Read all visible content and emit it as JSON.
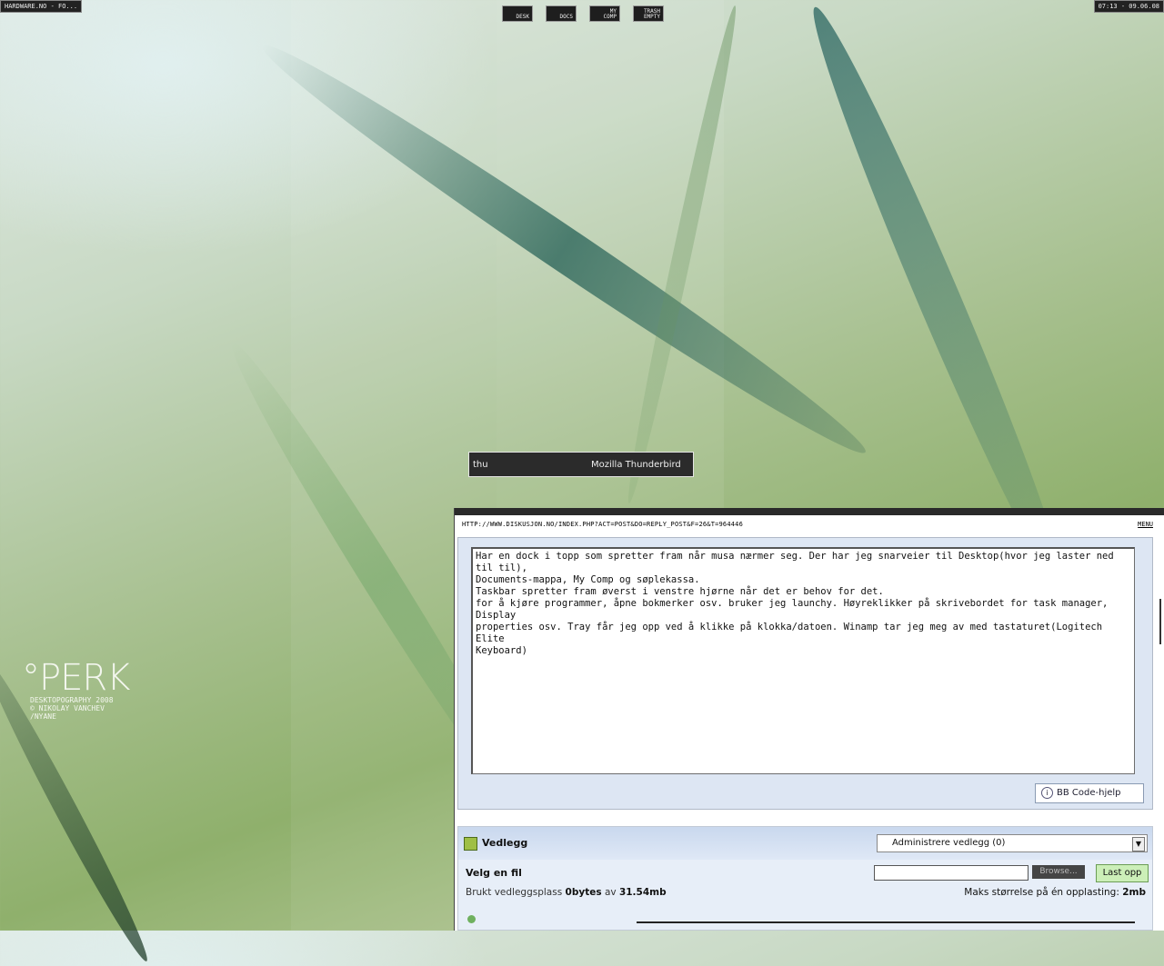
{
  "taskbar": {
    "active_window": "HARDWARE.NO - FO..."
  },
  "tray": {
    "clock": "07:13 - 09.06.08"
  },
  "dock": {
    "items": [
      {
        "label": "DESK"
      },
      {
        "label": "DOCS"
      },
      {
        "label": "MY COMP"
      },
      {
        "label": "TRASH EMPTY"
      }
    ]
  },
  "launcher": {
    "query": "thu",
    "result": "Mozilla Thunderbird"
  },
  "wallpaper": {
    "logo": "°PERK",
    "credit_lines": [
      "DESKTOPOGRAPHY 2008",
      "© NIKOLAY VANCHEV",
      "/NYANE"
    ]
  },
  "browser": {
    "url": "HTTP://WWW.DISKUSJON.NO/INDEX.PHP?ACT=POST&DO=REPLY_POST&F=26&T=964446",
    "menu_label": "MENU",
    "post_text": "Har en dock i topp som spretter fram når musa nærmer seg. Der har jeg snarveier til Desktop(hvor jeg laster ned til til),\nDocuments-mappa, My Comp og søplekassa.\nTaskbar spretter fram øverst i venstre hjørne når det er behov for det.\nfor å kjøre programmer, åpne bokmerker osv. bruker jeg launchy. Høyreklikker på skrivebordet for task manager, Display\nproperties osv. Tray får jeg opp ved å klikke på klokka/datoen. Winamp tar jeg meg av med tastaturet(Logitech Elite\nKeyboard)",
    "bbcode_button": "BB Code-hjelp",
    "attachments": {
      "title": "Vedlegg",
      "manage_select": "Administrere vedlegg (0)",
      "pick_file_label": "Velg en fil",
      "browse_label": "Browse...",
      "upload_label": "Last opp",
      "used_prefix": "Brukt vedleggsplass",
      "used_amount": "0bytes",
      "used_of": "av",
      "used_total": "31.54mb",
      "max_label": "Maks størrelse på én opplasting:",
      "max_value": "2mb"
    }
  },
  "colors": {
    "launcher_bg": "#2b2b2b",
    "upload_button": "#ccefb8",
    "attach_panel": "#e7eef8"
  }
}
